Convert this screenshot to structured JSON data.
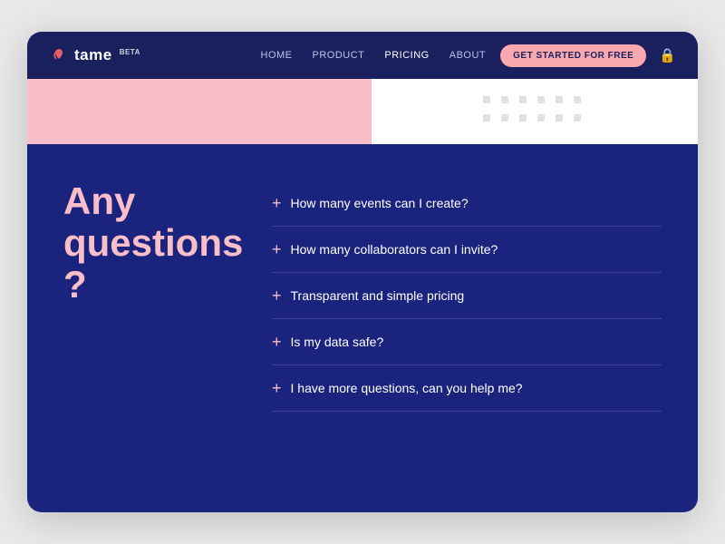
{
  "navbar": {
    "logo_text": "tame",
    "beta_label": "BETA",
    "nav_links": [
      {
        "label": "HOME",
        "active": false
      },
      {
        "label": "PRODUCT",
        "active": false
      },
      {
        "label": "PRICING",
        "active": true
      },
      {
        "label": "ABOUT",
        "active": false
      }
    ],
    "cta_label": "GET STARTED FOR FREE"
  },
  "main": {
    "headline_line1": "Any",
    "headline_line2": "questions ?",
    "faq_items": [
      {
        "text": "How many events can I create?"
      },
      {
        "text": "How many collaborators can I invite?"
      },
      {
        "text": "Transparent and simple pricing"
      },
      {
        "text": "Is my data safe?"
      },
      {
        "text": "I have more questions, can you help me?"
      }
    ]
  },
  "colors": {
    "navy": "#1a237e",
    "pink_light": "#f9bec7",
    "white": "#ffffff",
    "dot_color": "#e0e0e0"
  }
}
